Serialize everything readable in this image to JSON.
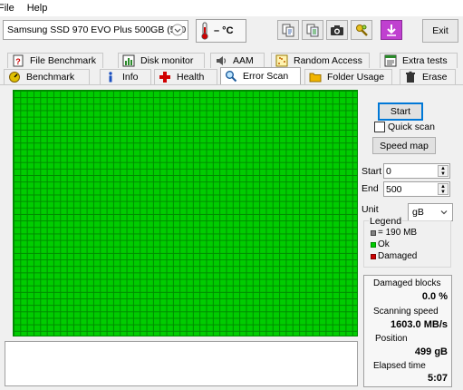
{
  "menu": {
    "file": "File",
    "help": "Help"
  },
  "toolbar": {
    "drive": "Samsung SSD 970 EVO Plus 500GB (500",
    "temperature": "– °C",
    "exit_label": "Exit",
    "icons": [
      "thermometer-icon",
      "copy-text-icon",
      "copy-all-icon",
      "screenshot-camera-icon",
      "tools-icon",
      "save-arrow-icon"
    ]
  },
  "tabs": {
    "row1": [
      {
        "label": "File Benchmark",
        "icon": "file-benchmark-icon"
      },
      {
        "label": "Disk monitor",
        "icon": "disk-monitor-icon"
      },
      {
        "label": "AAM",
        "icon": "speaker-icon"
      },
      {
        "label": "Random Access",
        "icon": "random-access-icon"
      },
      {
        "label": "Extra tests",
        "icon": "extra-tests-icon"
      }
    ],
    "row2": [
      {
        "label": "Benchmark",
        "icon": "benchmark-icon"
      },
      {
        "label": "Info",
        "icon": "info-icon"
      },
      {
        "label": "Health",
        "icon": "health-cross-icon"
      },
      {
        "label": "Error Scan",
        "icon": "magnifier-icon",
        "active": true
      },
      {
        "label": "Folder Usage",
        "icon": "folder-icon"
      },
      {
        "label": "Erase",
        "icon": "trash-icon"
      }
    ]
  },
  "controls": {
    "start_label": "Start",
    "quick_scan_label": "Quick scan",
    "quick_scan_checked": false,
    "speed_map_label": "Speed map",
    "start_field_label": "Start",
    "start_value": "0",
    "end_field_label": "End",
    "end_value": "500",
    "unit_label": "Unit",
    "unit_value": "gB"
  },
  "legend": {
    "title": "Legend",
    "items": [
      {
        "label": "= 190 MB",
        "color": "#808080"
      },
      {
        "label": "Ok",
        "color": "#00cc00"
      },
      {
        "label": "Damaged",
        "color": "#cc0000"
      }
    ]
  },
  "stats": {
    "damaged_blocks_label": "Damaged blocks",
    "damaged_blocks_value": "0.0 %",
    "scanning_speed_label": "Scanning speed",
    "scanning_speed_value": "1603.0 MB/s",
    "position_label": "Position",
    "position_value": "499 gB",
    "elapsed_label": "Elapsed time",
    "elapsed_value": "5:07"
  },
  "colors": {
    "ok_green": "#00cc00",
    "grid_line": "#008a00",
    "damaged_red": "#cc0000",
    "accent_blue": "#0078d7"
  }
}
